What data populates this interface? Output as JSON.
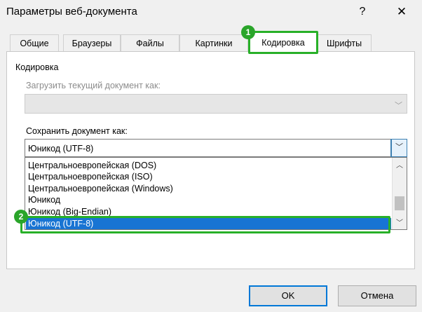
{
  "window": {
    "title": "Параметры веб-документа",
    "help_glyph": "?",
    "close_glyph": "✕"
  },
  "tabs": [
    {
      "label": "Общие",
      "active": false
    },
    {
      "label": "Браузеры",
      "active": false
    },
    {
      "label": "Файлы",
      "active": false
    },
    {
      "label": "Картинки",
      "active": false
    },
    {
      "label": "Кодировка",
      "active": true
    },
    {
      "label": "Шрифты",
      "active": false
    }
  ],
  "encoding": {
    "section_title": "Кодировка",
    "load_label": "Загрузить текущий документ как:",
    "load_value": "",
    "save_label": "Сохранить документ как:",
    "save_value": "Юникод (UTF-8)",
    "options": [
      "Центральноевропейская (DOS)",
      "Центральноевропейская (ISO)",
      "Центральноевропейская (Windows)",
      "Юникод",
      "Юникод (Big-Endian)",
      "Юникод (UTF-8)"
    ],
    "selected_option": "Юникод (UTF-8)"
  },
  "annotations": {
    "badge1": "1",
    "badge2": "2",
    "highlight_color": "#28b028"
  },
  "buttons": {
    "ok": "OK",
    "cancel": "Отмена"
  },
  "colors": {
    "selection": "#1874d3",
    "focus_border": "#0078d7"
  }
}
